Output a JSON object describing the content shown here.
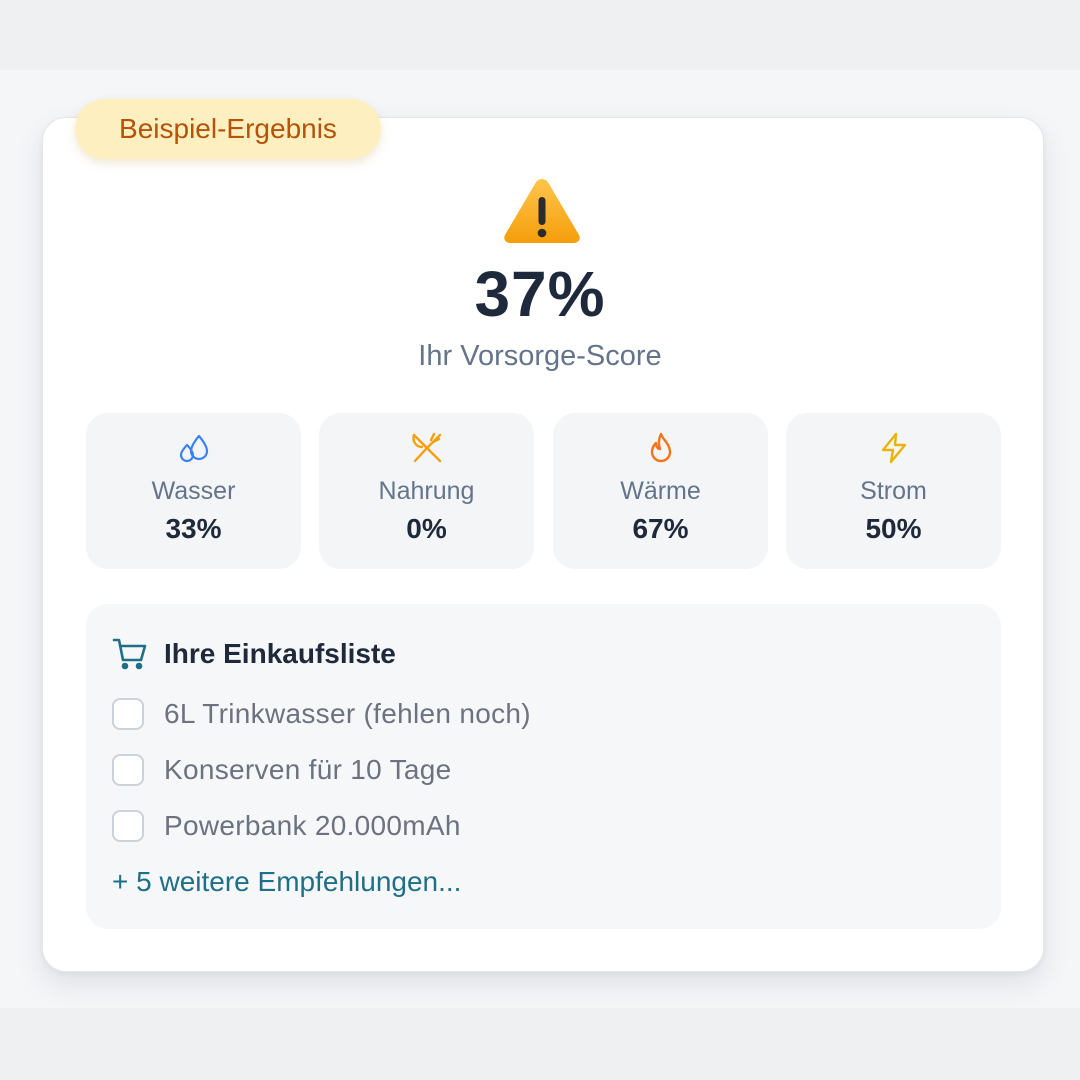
{
  "badge": {
    "label": "Beispiel-Ergebnis"
  },
  "score": {
    "value": "37%",
    "label": "Ihr Vorsorge-Score",
    "icon": "warning-icon"
  },
  "categories": [
    {
      "name": "Wasser",
      "value": "33%",
      "icon": "water-drops-icon",
      "color": "#3b82f6"
    },
    {
      "name": "Nahrung",
      "value": "0%",
      "icon": "utensils-crossed-icon",
      "color": "#f59e0b"
    },
    {
      "name": "Wärme",
      "value": "67%",
      "icon": "flame-icon",
      "color": "#f97316"
    },
    {
      "name": "Strom",
      "value": "50%",
      "icon": "lightning-icon",
      "color": "#eab308"
    }
  ],
  "shopping_list": {
    "title": "Ihre Einkaufsliste",
    "icon": "cart-icon",
    "items": [
      {
        "label": "6L Trinkwasser (fehlen noch)",
        "checked": false
      },
      {
        "label": "Konserven für 10 Tage",
        "checked": false
      },
      {
        "label": "Powerbank 20.000mAh",
        "checked": false
      }
    ],
    "more_link": "+ 5 weitere Empfehlungen..."
  },
  "colors": {
    "accent": "#1f6f86",
    "badge_bg": "#fdefbf",
    "badge_text": "#b45309"
  }
}
